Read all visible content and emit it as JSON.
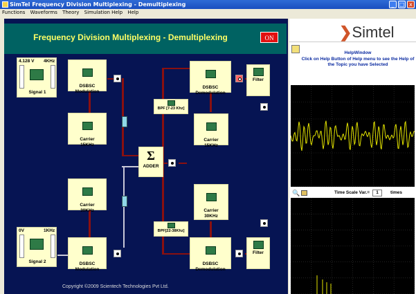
{
  "window": {
    "title": "SimTel Frequency Division Multiplexing - Demultiplexing",
    "min": "_",
    "max": "□",
    "close": "x"
  },
  "menu": [
    "Functions",
    "Waveforms",
    "Theory",
    "Simulation Help",
    "Help"
  ],
  "header": {
    "title": "Frequency Division Multiplexing - Demultiplexing",
    "on_label": "ON"
  },
  "signal1": {
    "voltage": "4.128 V",
    "freq": "4KHz",
    "name": "Signal 1"
  },
  "signal2": {
    "voltage": "0V",
    "freq": "1KHz",
    "name": "Signal 2"
  },
  "blocks": {
    "mod1": "DSBSC\nModulation",
    "carrier1": "Carrier\n15KHz",
    "carrier2": "Carrier\n30KHz",
    "mod2": "DSBSC\nModulation",
    "adder_symbol": "Σ",
    "adder": "ADDER",
    "demod1": "DSBSC\nDemodulation",
    "filter1": "Filter",
    "bpf1": "BPF [7-23 Khz]",
    "carrier3": "Carrier\n15KHz",
    "carrier4": "Carrier\n30KHz",
    "bpf2": "BPF[22-38Khz]",
    "demod2": "DSBSC\nDemodulation",
    "filter2": "Filter"
  },
  "copyright": "Copyright ©2009 Scientech Technologies Pvt Ltd.",
  "logo": "Simtel",
  "help": {
    "title": "HelpWindow",
    "text": "Click on Help Button of Help menu to see the Help of the Topic you have Selected"
  },
  "timescale": {
    "label": "Time Scale Var.=",
    "value": "1",
    "unit": "times"
  },
  "colors": {
    "panel": "#061453",
    "header": "#006262",
    "title": "#ffff66",
    "wire": "#8a1010",
    "trace": "#e6e600"
  }
}
